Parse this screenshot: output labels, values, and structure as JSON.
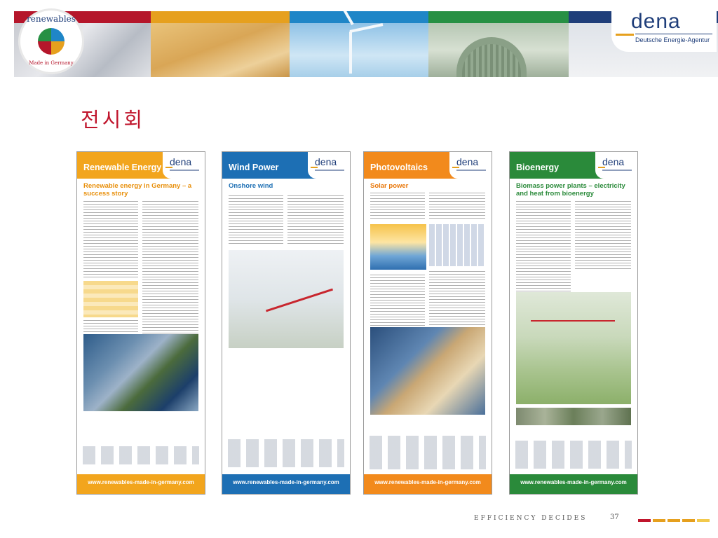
{
  "header": {
    "seal_top": "renewables",
    "seal_bottom": "Made in Germany",
    "logo_word": "dena",
    "logo_subtitle": "Deutsche Energie-Agentur",
    "band_colors": [
      "#b5162b",
      "#e6a01e",
      "#1f86c7",
      "#279044",
      "#1f3e7a"
    ]
  },
  "slide": {
    "title": "전시회"
  },
  "posters": [
    {
      "title": "Renewable Energy",
      "subtitle": "Renewable energy in Germany – a success story",
      "logo": "dena",
      "url": "www.renewables-made-in-germany.com",
      "color": "#f2a51d"
    },
    {
      "title": "Wind Power",
      "subtitle": "Onshore wind",
      "logo": "dena",
      "url": "www.renewables-made-in-germany.com",
      "color": "#1d6fb4"
    },
    {
      "title": "Photovoltaics",
      "subtitle": "Solar power",
      "logo": "dena",
      "url": "www.renewables-made-in-germany.com",
      "color": "#f28a1c"
    },
    {
      "title": "Bioenergy",
      "subtitle": "Biomass power plants – electricity and heat from bioenergy",
      "logo": "dena",
      "url": "www.renewables-made-in-germany.com",
      "color": "#2a8a3a"
    }
  ],
  "footer": {
    "tagline": "EFFICIENCY DECIDES",
    "page_number": "37",
    "dash_colors": [
      "#c0152c",
      "#e6a01e",
      "#e6a01e",
      "#e6a01e",
      "#f2c94c"
    ]
  }
}
